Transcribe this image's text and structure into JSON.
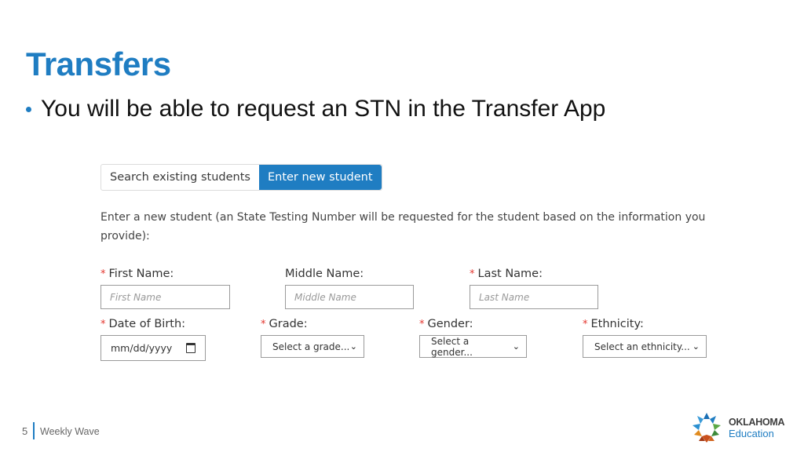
{
  "slide": {
    "title": "Transfers",
    "bullet": "You will be able to request an STN in the Transfer App"
  },
  "app": {
    "tabs": [
      {
        "label": "Search existing students",
        "active": false
      },
      {
        "label": "Enter new student",
        "active": true
      }
    ],
    "description": "Enter a new student (an State Testing Number will be requested for the student based on the information you provide):",
    "required_marker": "*",
    "fields": {
      "first_name": {
        "label": "First Name:",
        "placeholder": "First Name",
        "required": true
      },
      "middle_name": {
        "label": "Middle Name:",
        "placeholder": "Middle Name",
        "required": false
      },
      "last_name": {
        "label": "Last Name:",
        "placeholder": "Last Name",
        "required": true
      },
      "dob": {
        "label": "Date of Birth:",
        "value": "mm/dd/yyyy",
        "required": true
      },
      "grade": {
        "label": "Grade:",
        "selected": "Select a grade...",
        "required": true
      },
      "gender": {
        "label": "Gender:",
        "selected": "Select a gender...",
        "required": true
      },
      "ethnicity": {
        "label": "Ethnicity:",
        "selected": "Select an ethnicity...",
        "required": true
      }
    }
  },
  "footer": {
    "page_number": "5",
    "text": "Weekly Wave",
    "logo_line1": "OKLAHOMA",
    "logo_line2": "Education"
  },
  "colors": {
    "accent": "#1f7dc2",
    "required": "#e4362f"
  }
}
